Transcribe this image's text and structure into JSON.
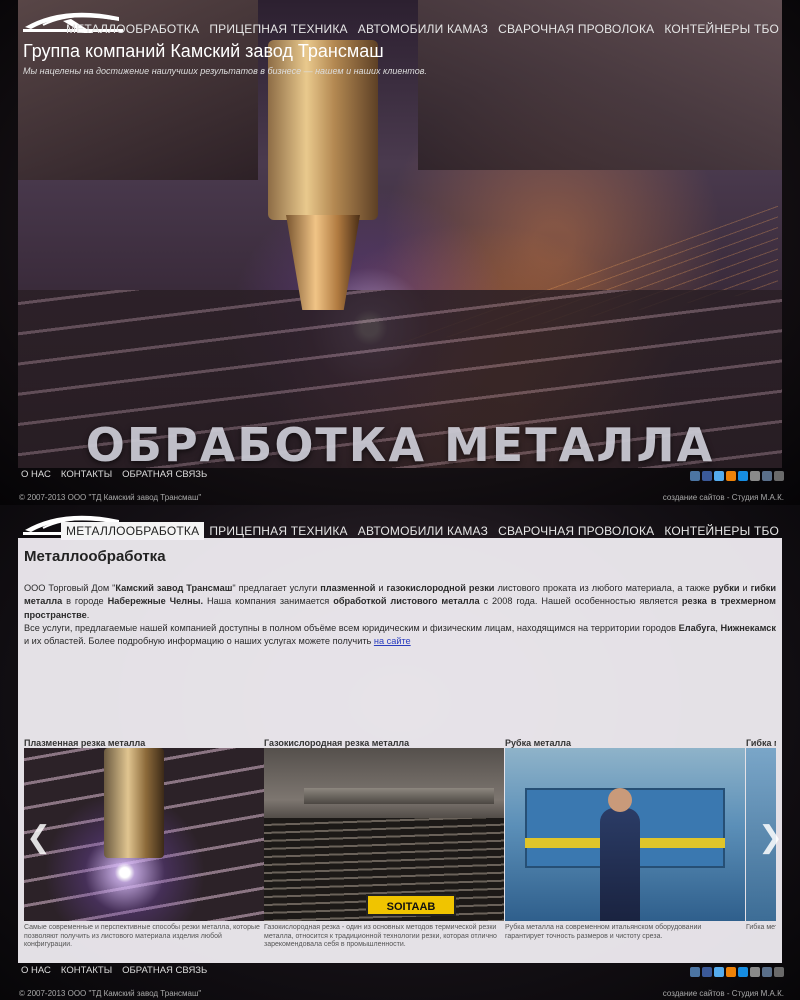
{
  "header": {
    "title": "Группа компаний Камский завод Трансмаш",
    "tagline": "Мы нацелены на достижение наилучших результатов в бизнесе — нашем и наших клиентов."
  },
  "nav": {
    "items": [
      {
        "label": "МЕТАЛЛООБРАБОТКА"
      },
      {
        "label": "ПРИЦЕПНАЯ ТЕХНИКА"
      },
      {
        "label": "АВТОМОБИЛИ КАМАЗ"
      },
      {
        "label": "СВАРОЧНАЯ ПРОВОЛОКА"
      },
      {
        "label": "КОНТЕЙНЕРЫ ТБО"
      }
    ],
    "active_index": 0
  },
  "hero": {
    "caption": "ОБРАБОТКА МЕТАЛЛА"
  },
  "footer": {
    "links": [
      {
        "label": "О НАС"
      },
      {
        "label": "КОНТАКТЫ"
      },
      {
        "label": "ОБРАТНАЯ СВЯЗЬ"
      }
    ],
    "copyright": "© 2007-2013 ООО \"ТД Камский завод Трансмаш\"",
    "studio_prefix": "создание сайтов - ",
    "studio_name": "Студия М.А.К."
  },
  "social_icons": [
    {
      "icon": "vk-icon",
      "color": "#4c75a3"
    },
    {
      "icon": "facebook-icon",
      "color": "#3b5998"
    },
    {
      "icon": "twitter-icon",
      "color": "#55acee"
    },
    {
      "icon": "odnoklassniki-icon",
      "color": "#ee8208"
    },
    {
      "icon": "mailru-icon",
      "color": "#168de2"
    },
    {
      "icon": "google-plus-icon",
      "color": "#8a8a8a"
    },
    {
      "icon": "livejournal-icon",
      "color": "#5a6f8a"
    },
    {
      "icon": "rss-icon",
      "color": "#6a6a6a"
    }
  ],
  "content": {
    "title": "Металлообработка",
    "p1_t1": "ООО Торговый Дом \"",
    "p1_b1": "Камский завод Трансмаш",
    "p1_t2": "\" предлагает услуги ",
    "p1_b2": "плазменной",
    "p1_t3": " и ",
    "p1_b3": "газокислородной резки",
    "p1_t4": " листового проката из любого материала, а также ",
    "p1_b4": "рубки",
    "p1_t5": " и ",
    "p1_b5": "гибки металла",
    "p1_t6": " в городе ",
    "p1_b6": "Набережные Челны.",
    "p1_t7": " Наша компания занимается ",
    "p1_b7": "обработкой листового металла",
    "p1_t8": " с 2008 года. Нашей особенностью является ",
    "p1_b8": "резка в трехмерном пространстве",
    "p1_t9": ".",
    "p2_t1": "Все услуги, предлагаемые нашей компанией доступны в полном объёме всем юридическим и физическим лицам, находящимся на территории городов ",
    "p2_b1": "Елабуга",
    "p2_t2": ", ",
    "p2_b2": "Нижнекамск",
    "p2_t3": " и их областей. Более подробную информацию о наших услугах можете получить ",
    "p2_link": "на сайте"
  },
  "services": [
    {
      "title": "Плазменная резка металла",
      "desc": "Самые современные и перспективные способы резки металла, которые позволяют получить из листового материала изделия любой конфигурации."
    },
    {
      "title": "Газокислородная резка металла",
      "desc": "Газокислородная резка - один из основных методов термической резки металла, относится к традиционной технологии резки, которая отлично зарекомендовала себя в промышленности."
    },
    {
      "title": "Рубка металла",
      "desc": "Рубка металла на современном итальянском оборудовании гарантирует точность размеров и чистоту среза."
    },
    {
      "title": "Гибка металла",
      "desc": "Гибка металла без сварочных швов служит..."
    }
  ],
  "gas_image_brand": "SOITAAB",
  "arrows": {
    "left": "❮",
    "right": "❯"
  }
}
